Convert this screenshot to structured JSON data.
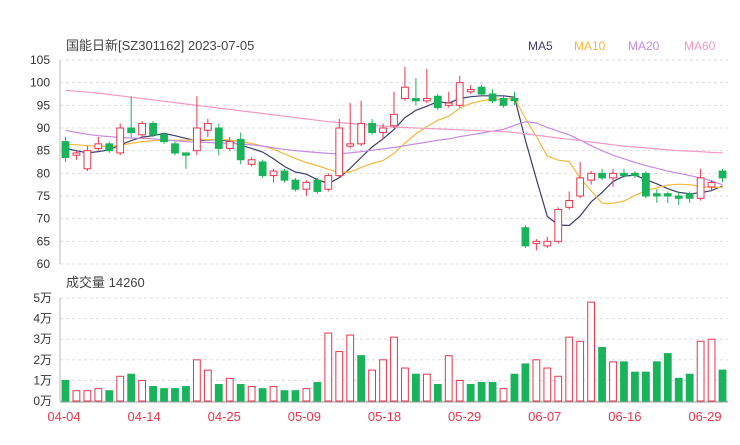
{
  "header": {
    "title": "国能日新[SZ301162] 2023-07-05",
    "legend": [
      {
        "label": "MA5",
        "color": "#3d3d6b"
      },
      {
        "label": "MA10",
        "color": "#f5b83d"
      },
      {
        "label": "MA20",
        "color": "#c58be0"
      },
      {
        "label": "MA60",
        "color": "#f29ac4"
      }
    ]
  },
  "volume_header": "成交量 14260",
  "colors": {
    "up": "#e8364e",
    "down": "#18b35a",
    "grid": "#dddddd",
    "axis_text": "#333333",
    "date_text": "#e8364e"
  },
  "chart_data": [
    {
      "type": "candlestick",
      "title": "国能日新[SZ301162] 2023-07-05",
      "ylim": [
        60,
        105
      ],
      "yticks": [
        "105",
        "100",
        "95",
        "90",
        "85",
        "80",
        "75",
        "70",
        "65",
        "60"
      ],
      "x_labels": [
        "04-04",
        "04-14",
        "04-25",
        "05-09",
        "05-18",
        "05-29",
        "06-07",
        "06-16",
        "06-29"
      ],
      "candles": [
        {
          "o": 87,
          "c": 83.5,
          "h": 88,
          "l": 82.5
        },
        {
          "o": 84,
          "c": 84.5,
          "h": 85,
          "l": 83
        },
        {
          "o": 81,
          "c": 85,
          "h": 86,
          "l": 80.5
        },
        {
          "o": 85.5,
          "c": 86.5,
          "h": 88,
          "l": 85
        },
        {
          "o": 86.5,
          "c": 85,
          "h": 87,
          "l": 84.5
        },
        {
          "o": 84.5,
          "c": 90,
          "h": 91,
          "l": 84
        },
        {
          "o": 90,
          "c": 89,
          "h": 97,
          "l": 88
        },
        {
          "o": 88.5,
          "c": 91,
          "h": 91.5,
          "l": 88
        },
        {
          "o": 91,
          "c": 88.5,
          "h": 91.5,
          "l": 88
        },
        {
          "o": 88.5,
          "c": 87,
          "h": 89,
          "l": 86.5
        },
        {
          "o": 86.5,
          "c": 84.5,
          "h": 87,
          "l": 84
        },
        {
          "o": 84.5,
          "c": 84,
          "h": 84.5,
          "l": 81
        },
        {
          "o": 85,
          "c": 90,
          "h": 97,
          "l": 84
        },
        {
          "o": 89.5,
          "c": 91,
          "h": 92,
          "l": 88
        },
        {
          "o": 90,
          "c": 85.5,
          "h": 91,
          "l": 84
        },
        {
          "o": 85.5,
          "c": 87,
          "h": 88,
          "l": 85
        },
        {
          "o": 87.5,
          "c": 83,
          "h": 89,
          "l": 82
        },
        {
          "o": 82,
          "c": 83,
          "h": 83.5,
          "l": 81.5
        },
        {
          "o": 82.5,
          "c": 79.5,
          "h": 83,
          "l": 79
        },
        {
          "o": 79.5,
          "c": 80.5,
          "h": 81,
          "l": 78
        },
        {
          "o": 80.5,
          "c": 78.5,
          "h": 81,
          "l": 78
        },
        {
          "o": 78.5,
          "c": 76.5,
          "h": 79,
          "l": 76
        },
        {
          "o": 76.5,
          "c": 78,
          "h": 78.5,
          "l": 75
        },
        {
          "o": 78.5,
          "c": 76,
          "h": 79,
          "l": 75.5
        },
        {
          "o": 76.5,
          "c": 79.5,
          "h": 80,
          "l": 76
        },
        {
          "o": 79.5,
          "c": 90,
          "h": 92,
          "l": 79
        },
        {
          "o": 86,
          "c": 86.5,
          "h": 95.5,
          "l": 85.5
        },
        {
          "o": 86.5,
          "c": 91,
          "h": 96,
          "l": 86
        },
        {
          "o": 91,
          "c": 89,
          "h": 92,
          "l": 88.5
        },
        {
          "o": 89,
          "c": 90,
          "h": 91,
          "l": 87.5
        },
        {
          "o": 90.5,
          "c": 93,
          "h": 98,
          "l": 90
        },
        {
          "o": 96.5,
          "c": 99,
          "h": 103.5,
          "l": 96
        },
        {
          "o": 96.5,
          "c": 96,
          "h": 101,
          "l": 95
        },
        {
          "o": 96,
          "c": 96.5,
          "h": 103,
          "l": 95.5
        },
        {
          "o": 97,
          "c": 94.5,
          "h": 97.5,
          "l": 94
        },
        {
          "o": 95,
          "c": 95.5,
          "h": 98,
          "l": 94.5
        },
        {
          "o": 95,
          "c": 100,
          "h": 101.5,
          "l": 94.5
        },
        {
          "o": 98,
          "c": 98.5,
          "h": 99.5,
          "l": 97.5
        },
        {
          "o": 99,
          "c": 97.5,
          "h": 99.5,
          "l": 97
        },
        {
          "o": 97.5,
          "c": 96,
          "h": 98.5,
          "l": 95.5
        },
        {
          "o": 96.5,
          "c": 95,
          "h": 97,
          "l": 94.5
        },
        {
          "o": 96.5,
          "c": 96,
          "h": 98,
          "l": 95
        },
        {
          "o": 68,
          "c": 64,
          "h": 68.5,
          "l": 63.5
        },
        {
          "o": 64.5,
          "c": 65,
          "h": 65.5,
          "l": 63
        },
        {
          "o": 64,
          "c": 65,
          "h": 66,
          "l": 63.5
        },
        {
          "o": 65,
          "c": 72,
          "h": 72.5,
          "l": 64.5
        },
        {
          "o": 72.5,
          "c": 74,
          "h": 76,
          "l": 72
        },
        {
          "o": 75,
          "c": 79,
          "h": 82.5,
          "l": 74.5
        },
        {
          "o": 78.5,
          "c": 80,
          "h": 80.5,
          "l": 77.5
        },
        {
          "o": 80,
          "c": 79,
          "h": 81,
          "l": 78.5
        },
        {
          "o": 79,
          "c": 80,
          "h": 81,
          "l": 77
        },
        {
          "o": 80,
          "c": 79.5,
          "h": 81,
          "l": 79
        },
        {
          "o": 80,
          "c": 79.5,
          "h": 80.5,
          "l": 79
        },
        {
          "o": 80,
          "c": 75,
          "h": 80.5,
          "l": 74.5
        },
        {
          "o": 75.5,
          "c": 75,
          "h": 76.5,
          "l": 73.5
        },
        {
          "o": 75.5,
          "c": 75,
          "h": 76,
          "l": 73.5
        },
        {
          "o": 75,
          "c": 74.5,
          "h": 76,
          "l": 73
        },
        {
          "o": 75.5,
          "c": 74.5,
          "h": 76,
          "l": 73.5
        },
        {
          "o": 74.5,
          "c": 79,
          "h": 81,
          "l": 74
        },
        {
          "o": 77,
          "c": 78,
          "h": 78.5,
          "l": 76
        },
        {
          "o": 80.5,
          "c": 79,
          "h": 81,
          "l": 78
        }
      ],
      "ma5": [
        85.5,
        85,
        84.5,
        84.8,
        85.2,
        86.3,
        87.2,
        88,
        88.3,
        88.8,
        88.3,
        87.7,
        87.2,
        87.3,
        87.5,
        87,
        86.2,
        85.5,
        84.7,
        83.2,
        81.5,
        80.3,
        79.8,
        78.6,
        77.8,
        79,
        81.1,
        83.5,
        85.8,
        87.6,
        89.7,
        92.3,
        93.9,
        94.8,
        95.8,
        95.5,
        96.5,
        96.9,
        97.1,
        97.1,
        97.1,
        96.8,
        87.3,
        78.7,
        70.5,
        68.6,
        68.5,
        70.6,
        73.7,
        75.8,
        78.2,
        79.4,
        79.6,
        78.6,
        77.7,
        76.6,
        75.8,
        75.5,
        75.7,
        76.2,
        77.2
      ],
      "ma10": [
        86.5,
        86.3,
        86.1,
        86,
        85.9,
        86.2,
        86.6,
        87,
        87.2,
        87.3,
        87.3,
        87.3,
        87.4,
        87.4,
        87.5,
        87.3,
        87,
        86.6,
        86,
        85.3,
        84.3,
        83.3,
        82.4,
        81.7,
        80.9,
        80.2,
        80.3,
        81.3,
        82.2,
        82.8,
        84.4,
        86.7,
        88.7,
        90.3,
        91.7,
        92.6,
        94.4,
        95.4,
        96,
        96.4,
        96.3,
        96.6,
        92.1,
        88.1,
        83.8,
        82.9,
        82.6,
        78.9,
        76.2,
        73.4,
        73.4,
        73.9,
        75.1,
        76.2,
        76.8,
        77.4,
        77.6,
        77.5,
        77.1,
        76.9,
        76.9
      ],
      "ma20": [
        89.5,
        89,
        88.6,
        88.3,
        88.1,
        87.9,
        87.8,
        87.7,
        87.6,
        87.4,
        87.2,
        87,
        86.9,
        86.8,
        86.7,
        86.6,
        86.5,
        86.3,
        86,
        85.6,
        85.3,
        85,
        84.8,
        84.6,
        84.4,
        84.3,
        84.5,
        84.8,
        85.1,
        85.4,
        85.7,
        86.1,
        86.5,
        86.9,
        87.3,
        87.6,
        88.1,
        88.5,
        88.9,
        89.3,
        89.7,
        90.6,
        91.4,
        91.1,
        90.1,
        89.3,
        88.5,
        87.3,
        86.1,
        85,
        84,
        83.2,
        82.4,
        81.7,
        81.1,
        80.5,
        80,
        79.5,
        79,
        78.3,
        77.5
      ],
      "ma60": [
        98.3,
        98.1,
        97.9,
        97.7,
        97.4,
        97.1,
        96.8,
        96.5,
        96.2,
        95.9,
        95.6,
        95.3,
        95,
        94.7,
        94.4,
        94.1,
        93.8,
        93.5,
        93.2,
        92.9,
        92.6,
        92.3,
        92,
        91.7,
        91.4,
        91.2,
        91,
        90.8,
        90.6,
        90.4,
        90.2,
        90.1,
        90,
        89.9,
        89.8,
        89.7,
        89.6,
        89.5,
        89.4,
        89.3,
        89.2,
        89,
        88.7,
        88.4,
        88.1,
        87.8,
        87.5,
        87.2,
        86.9,
        86.6,
        86.3,
        86,
        85.8,
        85.6,
        85.4,
        85.2,
        85,
        84.9,
        84.8,
        84.6,
        84.5
      ]
    },
    {
      "type": "bar",
      "title": "成交量 14260",
      "ylim": [
        0,
        5
      ],
      "yticks": [
        "5万",
        "4万",
        "3万",
        "2万",
        "1万",
        "0万"
      ],
      "values": [
        1,
        0.5,
        0.5,
        0.6,
        0.5,
        1.2,
        1.3,
        1,
        0.7,
        0.6,
        0.6,
        0.7,
        2,
        1.5,
        0.8,
        1.1,
        0.8,
        0.7,
        0.6,
        0.7,
        0.5,
        0.5,
        0.6,
        0.9,
        3.3,
        2.4,
        3.2,
        2.2,
        1.5,
        2,
        3.1,
        1.6,
        1.3,
        1.3,
        0.8,
        2.2,
        1,
        0.8,
        0.9,
        0.9,
        0.6,
        1.3,
        1.8,
        2,
        1.6,
        1.2,
        3.1,
        2.9,
        4.8,
        2.6,
        1.9,
        1.9,
        1.4,
        1.4,
        1.9,
        2.3,
        1.1,
        1.3,
        2.9,
        3,
        1.5
      ],
      "up": [
        false,
        true,
        true,
        true,
        false,
        true,
        false,
        true,
        false,
        false,
        false,
        false,
        true,
        true,
        false,
        true,
        false,
        true,
        false,
        true,
        false,
        false,
        true,
        false,
        true,
        true,
        true,
        false,
        true,
        true,
        true,
        true,
        false,
        true,
        false,
        true,
        true,
        false,
        false,
        false,
        true,
        false,
        false,
        true,
        true,
        true,
        true,
        true,
        true,
        false,
        true,
        false,
        false,
        false,
        false,
        false,
        false,
        false,
        true,
        true,
        false
      ]
    }
  ]
}
